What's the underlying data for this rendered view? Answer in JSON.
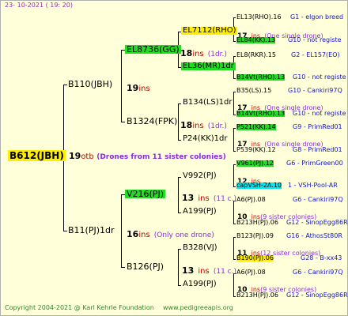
{
  "date": "23- 10-2021 ( 19: 20)",
  "root": {
    "name": "B612(JBH)",
    "num": "19",
    "unit": "otb",
    "note": "(Drones from 11 sister colonies)"
  },
  "gen1": [
    {
      "name": "B110(JBH)",
      "num": "19",
      "unit": "ins",
      "note": ""
    },
    {
      "name": "B11(PJ)1dr",
      "num": "16",
      "unit": "ins",
      "note": "(Only one drone)"
    }
  ],
  "gen2": [
    {
      "name": "EL8736(GG)",
      "num": "18",
      "unit": "ins",
      "note": "(1dr.)"
    },
    {
      "name": "B1324(FPK)",
      "num": "18",
      "unit": "ins",
      "note": "(1dr.)"
    },
    {
      "name": "V216(PJ)",
      "num": "13",
      "unit": "ins",
      "note": "(11 c.)"
    },
    {
      "name": "B126(PJ)",
      "num": "13",
      "unit": "ins",
      "note": "(11 c.)"
    }
  ],
  "gen3": [
    {
      "name": "EL7112(RHO)",
      "num": "17",
      "unit": "ins",
      "note": "(One single drone)"
    },
    {
      "name": "EL36(MR)1dr",
      "num": "",
      "unit": "",
      "note": ""
    },
    {
      "name": "B134(LS)1dr",
      "num": "17",
      "unit": "ins",
      "note": "(One single drone)"
    },
    {
      "name": "P24(KK)1dr",
      "num": "17",
      "unit": "ins",
      "note": "(One single drone)"
    },
    {
      "name": "V992(PJ)",
      "num": "12",
      "unit": "ins",
      "note": ""
    },
    {
      "name": "A199(PJ)",
      "num": "10",
      "unit": "ins",
      "note": "(9 sister colonies)"
    },
    {
      "name": "B328(VJ)",
      "num": "11",
      "unit": "ins",
      "note": "(12 sister colonies)"
    },
    {
      "name": "A199(PJ)",
      "num": "10",
      "unit": "ins",
      "note": "(9 sister colonies)"
    }
  ],
  "gen4": [
    {
      "name": "EL13(RHO).16",
      "info": "G1 - elgon breed"
    },
    {
      "name": "EL84(KK).13",
      "info": "G10 - not registe"
    },
    {
      "name": "EL8(RKR).15",
      "info": "G2 - EL157(EO)"
    },
    {
      "name": "B14Vt(RHO).13",
      "info": "G10 - not registe"
    },
    {
      "name": "B35(LS).15",
      "info": "G10 - Cankiri97Q"
    },
    {
      "name": "B14Vt(RHO).13",
      "info": "G10 - not registe"
    },
    {
      "name": "P521(KK).14",
      "info": "G9 - PrimRed01"
    },
    {
      "name": "P539(KK).12",
      "info": "G8 - PrimRed01"
    },
    {
      "name": "V961(PJ).12",
      "info": "G6 - PrimGreen00"
    },
    {
      "name": "capVSH-2A.10",
      "info": "1 - VSH-Pool-AR"
    },
    {
      "name": "A6(PJ).08",
      "info": "G6 - Cankiri97Q"
    },
    {
      "name": "B213H(PJ).06",
      "info": "G12 - SinopEgg86R"
    },
    {
      "name": "B123(PJ).09",
      "info": "G16 - AthosSt80R"
    },
    {
      "name": "B190(PJ).06",
      "info": "G28 - B-xx43"
    },
    {
      "name": "A6(PJ).08",
      "info": "G6 - Cankiri97Q"
    },
    {
      "name": "B213H(PJ).06",
      "info": "G12 - SinopEgg86R"
    }
  ],
  "footer": {
    "copyright": "Copyright 2004-2021 @ Karl Kehrle Foundation",
    "site": "www.pedigreeapis.org"
  }
}
